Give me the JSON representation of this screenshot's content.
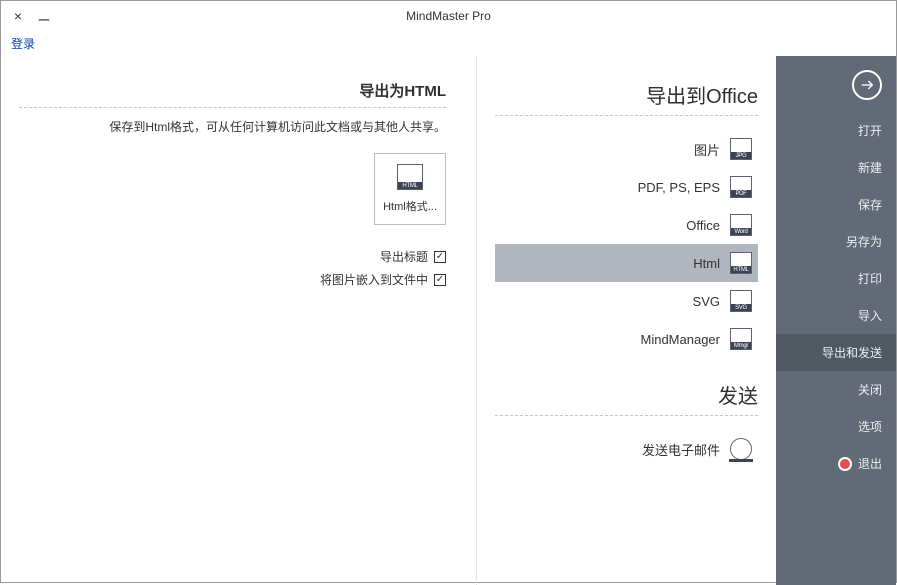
{
  "titlebar": {
    "title": "MindMaster Pro"
  },
  "login_label": "登录",
  "sidebar": {
    "items": [
      {
        "label": "打开"
      },
      {
        "label": "新建"
      },
      {
        "label": "保存"
      },
      {
        "label": "另存为"
      },
      {
        "label": "打印"
      },
      {
        "label": "导入"
      },
      {
        "label": "导出和发送"
      },
      {
        "label": "关闭"
      },
      {
        "label": "选项"
      },
      {
        "label": "退出"
      }
    ]
  },
  "export": {
    "section1_title": "导出到Office",
    "items": [
      {
        "label": "图片",
        "band": "JPG"
      },
      {
        "label": "PDF, PS, EPS",
        "band": "PDF"
      },
      {
        "label": "Office",
        "band": "Word"
      },
      {
        "label": "Html",
        "band": "HTML"
      },
      {
        "label": "SVG",
        "band": "SVG"
      },
      {
        "label": "MindManager",
        "band": "Mmgr"
      }
    ],
    "section2_title": "发送",
    "send_label": "发送电子邮件"
  },
  "detail": {
    "title": "导出为HTML",
    "desc": "保存到Html格式，可从任何计算机访问此文档或与其他人共享。",
    "format_label": "Html格式...",
    "format_band": "HTML",
    "chk1": "导出标题",
    "chk2": "将图片嵌入到文件中"
  }
}
